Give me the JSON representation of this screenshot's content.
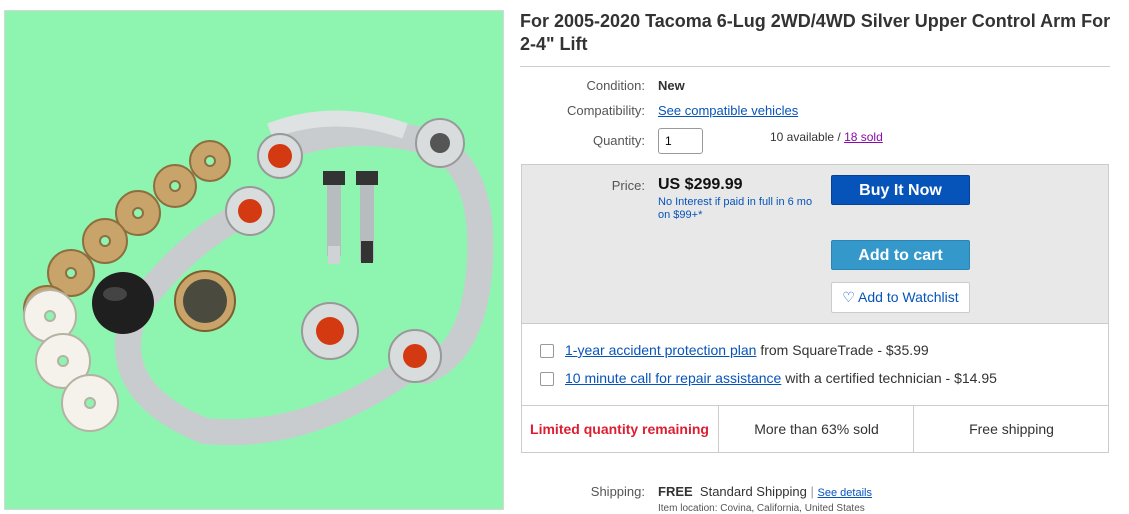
{
  "listing": {
    "title": "For 2005-2020 Tacoma 6-Lug 2WD/4WD Silver Upper Control Arm For 2-4\" Lift"
  },
  "condition": {
    "label": "Condition:",
    "value": "New"
  },
  "compatibility": {
    "label": "Compatibility:",
    "link": "See compatible vehicles"
  },
  "quantity": {
    "label": "Quantity:",
    "value": "1",
    "available": "10 available /",
    "sold_link": "18 sold"
  },
  "price": {
    "label": "Price:",
    "amount": "US $299.99",
    "financing": "No Interest if paid in full in 6 mo on $99+*"
  },
  "buttons": {
    "buy_now": "Buy It Now",
    "add_to_cart": "Add to cart",
    "watchlist": "Add to Watchlist"
  },
  "addons": [
    {
      "link": "1-year accident protection plan",
      "text": "from SquareTrade - $35.99"
    },
    {
      "link": "10 minute call for repair assistance",
      "text": "with a certified technician - $14.95"
    }
  ],
  "badges": {
    "limited": "Limited quantity remaining",
    "sold_percent": "More than 63% sold",
    "shipping": "Free shipping"
  },
  "shipping": {
    "label": "Shipping:",
    "free": "FREE",
    "method": "Standard Shipping",
    "details_link": "See details",
    "location": "Item location:  Covina, California, United States"
  },
  "colors": {
    "image_bg": "#8ef5b1",
    "buy_now": "#0654ba",
    "add_to_cart": "#3498ca",
    "limited_red": "#dd1e31",
    "link_blue": "#0654ba"
  }
}
